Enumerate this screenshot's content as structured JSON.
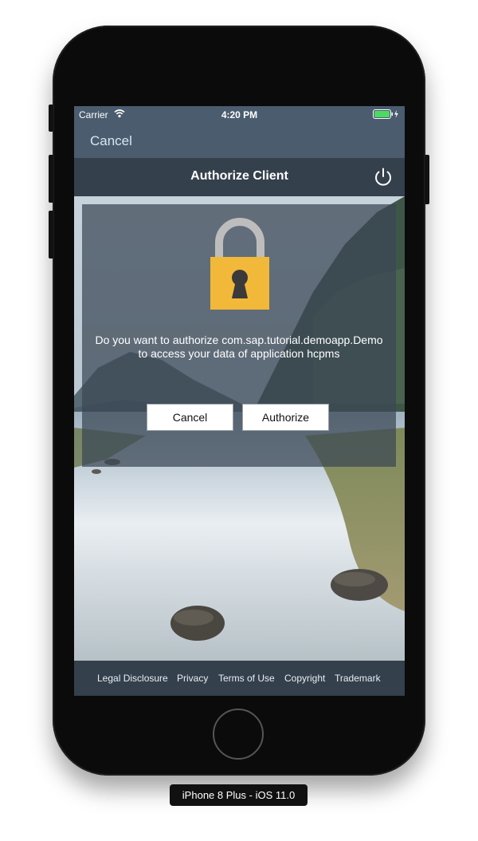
{
  "status_bar": {
    "carrier": "Carrier",
    "time": "4:20 PM",
    "wifi_icon": "wifi-icon",
    "battery_icon": "battery-charging-icon"
  },
  "nav": {
    "cancel_label": "Cancel"
  },
  "title_bar": {
    "title": "Authorize Client",
    "power_icon": "power-icon"
  },
  "dialog": {
    "lock_icon": "padlock-icon",
    "message_line1": "Do you want to authorize com.sap.tutorial.demoapp.Demo",
    "message_line2": "to access your data of application hcpms",
    "cancel_label": "Cancel",
    "authorize_label": "Authorize"
  },
  "footer": {
    "links": [
      "Legal Disclosure",
      "Privacy",
      "Terms of Use",
      "Copyright",
      "Trademark"
    ]
  },
  "device": {
    "label": "iPhone 8 Plus - iOS 11.0"
  },
  "colors": {
    "nav_bar": "#4a5c6e",
    "title_bar": "#34404c",
    "lock_body": "#f2b83a",
    "lock_shackle": "#bdbdbd",
    "link_text": "#d8e6f2"
  }
}
